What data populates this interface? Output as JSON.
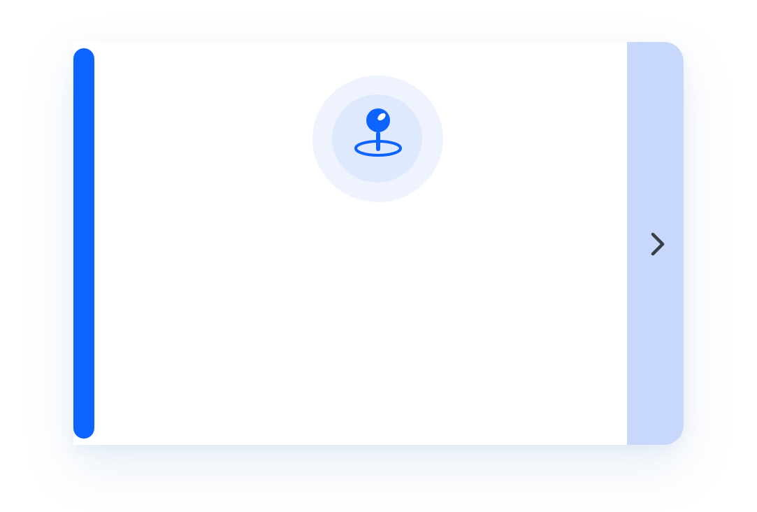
{
  "card": {
    "icon": "map-pin-icon",
    "action_icon": "chevron-right-icon"
  },
  "colors": {
    "accent": "#0d63fe",
    "side_panel": "#c8d8fd",
    "halo_outer": "#eef3fe",
    "halo_inner": "#dfe9fd",
    "chevron": "#3a3f47"
  }
}
